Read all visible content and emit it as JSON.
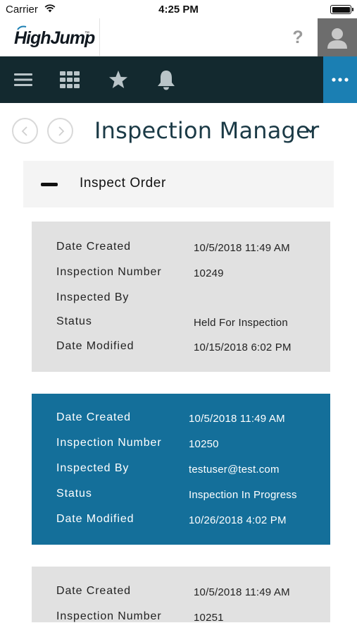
{
  "status_bar": {
    "carrier": "Carrier",
    "time": "4:25 PM"
  },
  "header": {
    "logo_text": "HighJump",
    "logo_tm": "™",
    "help_label": "?"
  },
  "nav": {
    "icons": [
      "menu-icon",
      "apps-grid-icon",
      "star-icon",
      "bell-icon",
      "more-icon"
    ]
  },
  "page": {
    "title": "Inspection Manager"
  },
  "section": {
    "title": "Inspect Order"
  },
  "fields": {
    "date_created": "Date Created",
    "inspection_number": "Inspection Number",
    "inspected_by": "Inspected By",
    "status": "Status",
    "date_modified": "Date Modified"
  },
  "inspections": [
    {
      "date_created": "10/5/2018 11:49 AM",
      "inspection_number": "10249",
      "inspected_by": "",
      "status": "Held For Inspection",
      "date_modified": "10/15/2018 6:02 PM",
      "selected": false
    },
    {
      "date_created": "10/5/2018 11:49 AM",
      "inspection_number": "10250",
      "inspected_by": "testuser@test.com",
      "status": "Inspection In Progress",
      "date_modified": "10/26/2018 4:02 PM",
      "selected": true
    },
    {
      "date_created": "10/5/2018 11:49 AM",
      "inspection_number": "10251",
      "selected": false
    }
  ],
  "colors": {
    "nav_background": "#13292f",
    "accent_blue": "#146f9a",
    "card_gray": "#e1e1e1",
    "title_color": "#1b3a46"
  }
}
